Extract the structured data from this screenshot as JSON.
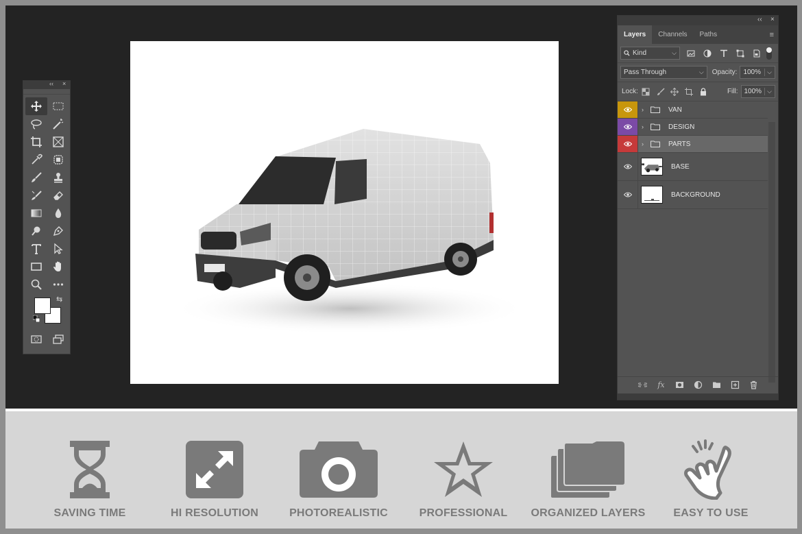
{
  "workspace": {
    "background": "#232323",
    "canvas_background": "#ffffff"
  },
  "toolbox": {
    "collapse_label": "‹‹",
    "close_label": "×",
    "tools": [
      {
        "name": "move-tool",
        "icon": "move-icon",
        "active": true
      },
      {
        "name": "marquee-tool",
        "icon": "rectangular-marquee-icon"
      },
      {
        "name": "lasso-tool",
        "icon": "lasso-icon"
      },
      {
        "name": "magic-wand-tool",
        "icon": "magic-wand-icon"
      },
      {
        "name": "crop-tool",
        "icon": "crop-icon"
      },
      {
        "name": "frame-tool",
        "icon": "frame-icon"
      },
      {
        "name": "eyedropper-tool",
        "icon": "eyedropper-icon"
      },
      {
        "name": "healing-tool",
        "icon": "spot-healing-icon"
      },
      {
        "name": "brush-tool",
        "icon": "brush-icon"
      },
      {
        "name": "stamp-tool",
        "icon": "clone-stamp-icon"
      },
      {
        "name": "history-brush-tool",
        "icon": "history-brush-icon"
      },
      {
        "name": "eraser-tool",
        "icon": "eraser-icon"
      },
      {
        "name": "gradient-tool",
        "icon": "gradient-icon"
      },
      {
        "name": "blur-tool",
        "icon": "blur-drop-icon"
      },
      {
        "name": "dodge-tool",
        "icon": "dodge-icon"
      },
      {
        "name": "pen-tool",
        "icon": "pen-icon"
      },
      {
        "name": "type-tool",
        "icon": "type-icon"
      },
      {
        "name": "path-select-tool",
        "icon": "arrow-select-icon"
      },
      {
        "name": "shape-tool",
        "icon": "rectangle-icon"
      },
      {
        "name": "hand-tool",
        "icon": "hand-icon"
      },
      {
        "name": "zoom-tool",
        "icon": "zoom-icon"
      },
      {
        "name": "more-tools",
        "icon": "ellipsis-icon"
      }
    ]
  },
  "layers_panel": {
    "collapse_label": "‹‹",
    "close_label": "×",
    "tabs": [
      {
        "label": "Layers",
        "active": true
      },
      {
        "label": "Channels",
        "active": false
      },
      {
        "label": "Paths",
        "active": false
      }
    ],
    "filter": {
      "value": "Kind"
    },
    "blend_mode": {
      "value": "Pass Through"
    },
    "opacity": {
      "label": "Opacity:",
      "value": "100%"
    },
    "lock": {
      "label": "Lock:"
    },
    "fill": {
      "label": "Fill:",
      "value": "100%"
    },
    "layers": [
      {
        "name": "VAN",
        "type": "group",
        "eye_color": "#c8960c"
      },
      {
        "name": "DESIGN",
        "type": "group",
        "eye_color": "#7b4aa6"
      },
      {
        "name": "PARTS",
        "type": "group",
        "eye_color": "#c63a3a",
        "selected": true
      },
      {
        "name": "BASE",
        "type": "image",
        "eye_color": "#535353"
      },
      {
        "name": "BACKGROUND",
        "type": "image",
        "eye_color": "#535353"
      }
    ]
  },
  "features": [
    {
      "label": "SAVING TIME",
      "icon": "hourglass-icon"
    },
    {
      "label": "HI RESOLUTION",
      "icon": "expand-arrows-icon"
    },
    {
      "label": "PHOTOREALISTIC",
      "icon": "camera-icon"
    },
    {
      "label": "PROFESSIONAL",
      "icon": "star-icon"
    },
    {
      "label": "ORGANIZED LAYERS",
      "icon": "stacked-folders-icon"
    },
    {
      "label": "EASY TO USE",
      "icon": "pointing-hand-icon"
    }
  ]
}
